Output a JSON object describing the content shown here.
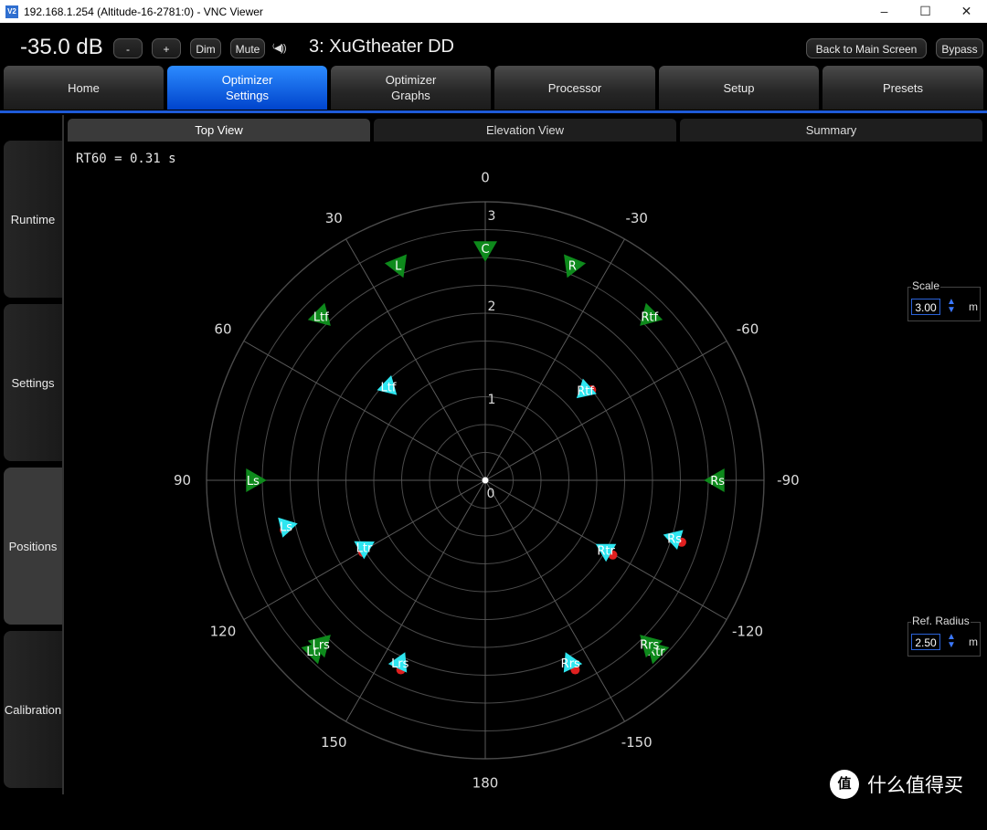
{
  "window": {
    "app_icon": "V2",
    "title": "192.168.1.254 (Altitude-16-2781:0) - VNC Viewer",
    "minimize": "–",
    "maximize": "☐",
    "close": "✕"
  },
  "header": {
    "volume": "-35.0 dB",
    "minus_label": "-",
    "plus_label": "+",
    "dim_label": "Dim",
    "mute_label": "Mute",
    "speaker_icon": "speaker-wave-icon",
    "preset_name": "3: XuGtheater DD",
    "back_label": "Back to Main Screen",
    "bypass_label": "Bypass"
  },
  "main_tabs": [
    {
      "line1": "Home",
      "line2": ""
    },
    {
      "line1": "Optimizer",
      "line2": "Settings"
    },
    {
      "line1": "Optimizer",
      "line2": "Graphs"
    },
    {
      "line1": "Processor",
      "line2": ""
    },
    {
      "line1": "Setup",
      "line2": ""
    },
    {
      "line1": "Presets",
      "line2": ""
    }
  ],
  "sidebar": [
    "Runtime",
    "Settings",
    "Positions",
    "Calibration"
  ],
  "subtabs": [
    "Top View",
    "Elevation View",
    "Summary"
  ],
  "rt60": "RT60 = 0.31 s",
  "scale": {
    "label": "Scale",
    "value": "3.00",
    "unit": "m"
  },
  "ref_radius": {
    "label": "Ref. Radius",
    "value": "2.50",
    "unit": "m"
  },
  "polar": {
    "max_radius_m": 3,
    "radial_labels": [
      "3",
      "2",
      "1",
      "0"
    ],
    "angle_labels": [
      {
        "deg": 0,
        "text": "0"
      },
      {
        "deg": 30,
        "text": "30"
      },
      {
        "deg": 60,
        "text": "60"
      },
      {
        "deg": 90,
        "text": "90"
      },
      {
        "deg": 120,
        "text": "120"
      },
      {
        "deg": 150,
        "text": "150"
      },
      {
        "deg": 180,
        "text": "180"
      },
      {
        "deg": -30,
        "text": "-30"
      },
      {
        "deg": -60,
        "text": "-60"
      },
      {
        "deg": -90,
        "text": "-90"
      },
      {
        "deg": -120,
        "text": "-120"
      },
      {
        "deg": -150,
        "text": "-150"
      }
    ],
    "speakers_nominal": [
      {
        "label": "C",
        "angle": 0,
        "radius": 2.5
      },
      {
        "label": "L",
        "angle": 22,
        "radius": 2.5
      },
      {
        "label": "R",
        "angle": -22,
        "radius": 2.5
      },
      {
        "label": "Ltf",
        "angle": 45,
        "radius": 2.5
      },
      {
        "label": "Rtf",
        "angle": -45,
        "radius": 2.5
      },
      {
        "label": "Ls",
        "angle": 90,
        "radius": 2.5
      },
      {
        "label": "Rs",
        "angle": -90,
        "radius": 2.5
      },
      {
        "label": "Ltr",
        "angle": 135,
        "radius": 2.6
      },
      {
        "label": "Lrs",
        "angle": 135,
        "radius": 2.5
      },
      {
        "label": "Rtr",
        "angle": -135,
        "radius": 2.6
      },
      {
        "label": "Rrs",
        "angle": -135,
        "radius": 2.5
      }
    ],
    "speakers_measured": [
      {
        "label": "Ltf",
        "angle": 46,
        "radius": 1.45
      },
      {
        "label": "Rtf",
        "angle": -48,
        "radius": 1.45
      },
      {
        "label": "Ls",
        "angle": 103,
        "radius": 2.2
      },
      {
        "label": "Rs",
        "angle": -107,
        "radius": 2.13
      },
      {
        "label": "Ltr",
        "angle": 119,
        "radius": 1.49
      },
      {
        "label": "Rtr",
        "angle": -120,
        "radius": 1.5
      },
      {
        "label": "Lrs",
        "angle": 155,
        "radius": 2.17
      },
      {
        "label": "Rrs",
        "angle": -155,
        "radius": 2.17
      }
    ],
    "colors": {
      "nominal": "#0e8a1c",
      "measured": "#2ee6f0",
      "measured_dot": "#e02020",
      "grid": "#4a4a4a"
    }
  },
  "watermark": {
    "icon": "值",
    "text": "什么值得买"
  }
}
